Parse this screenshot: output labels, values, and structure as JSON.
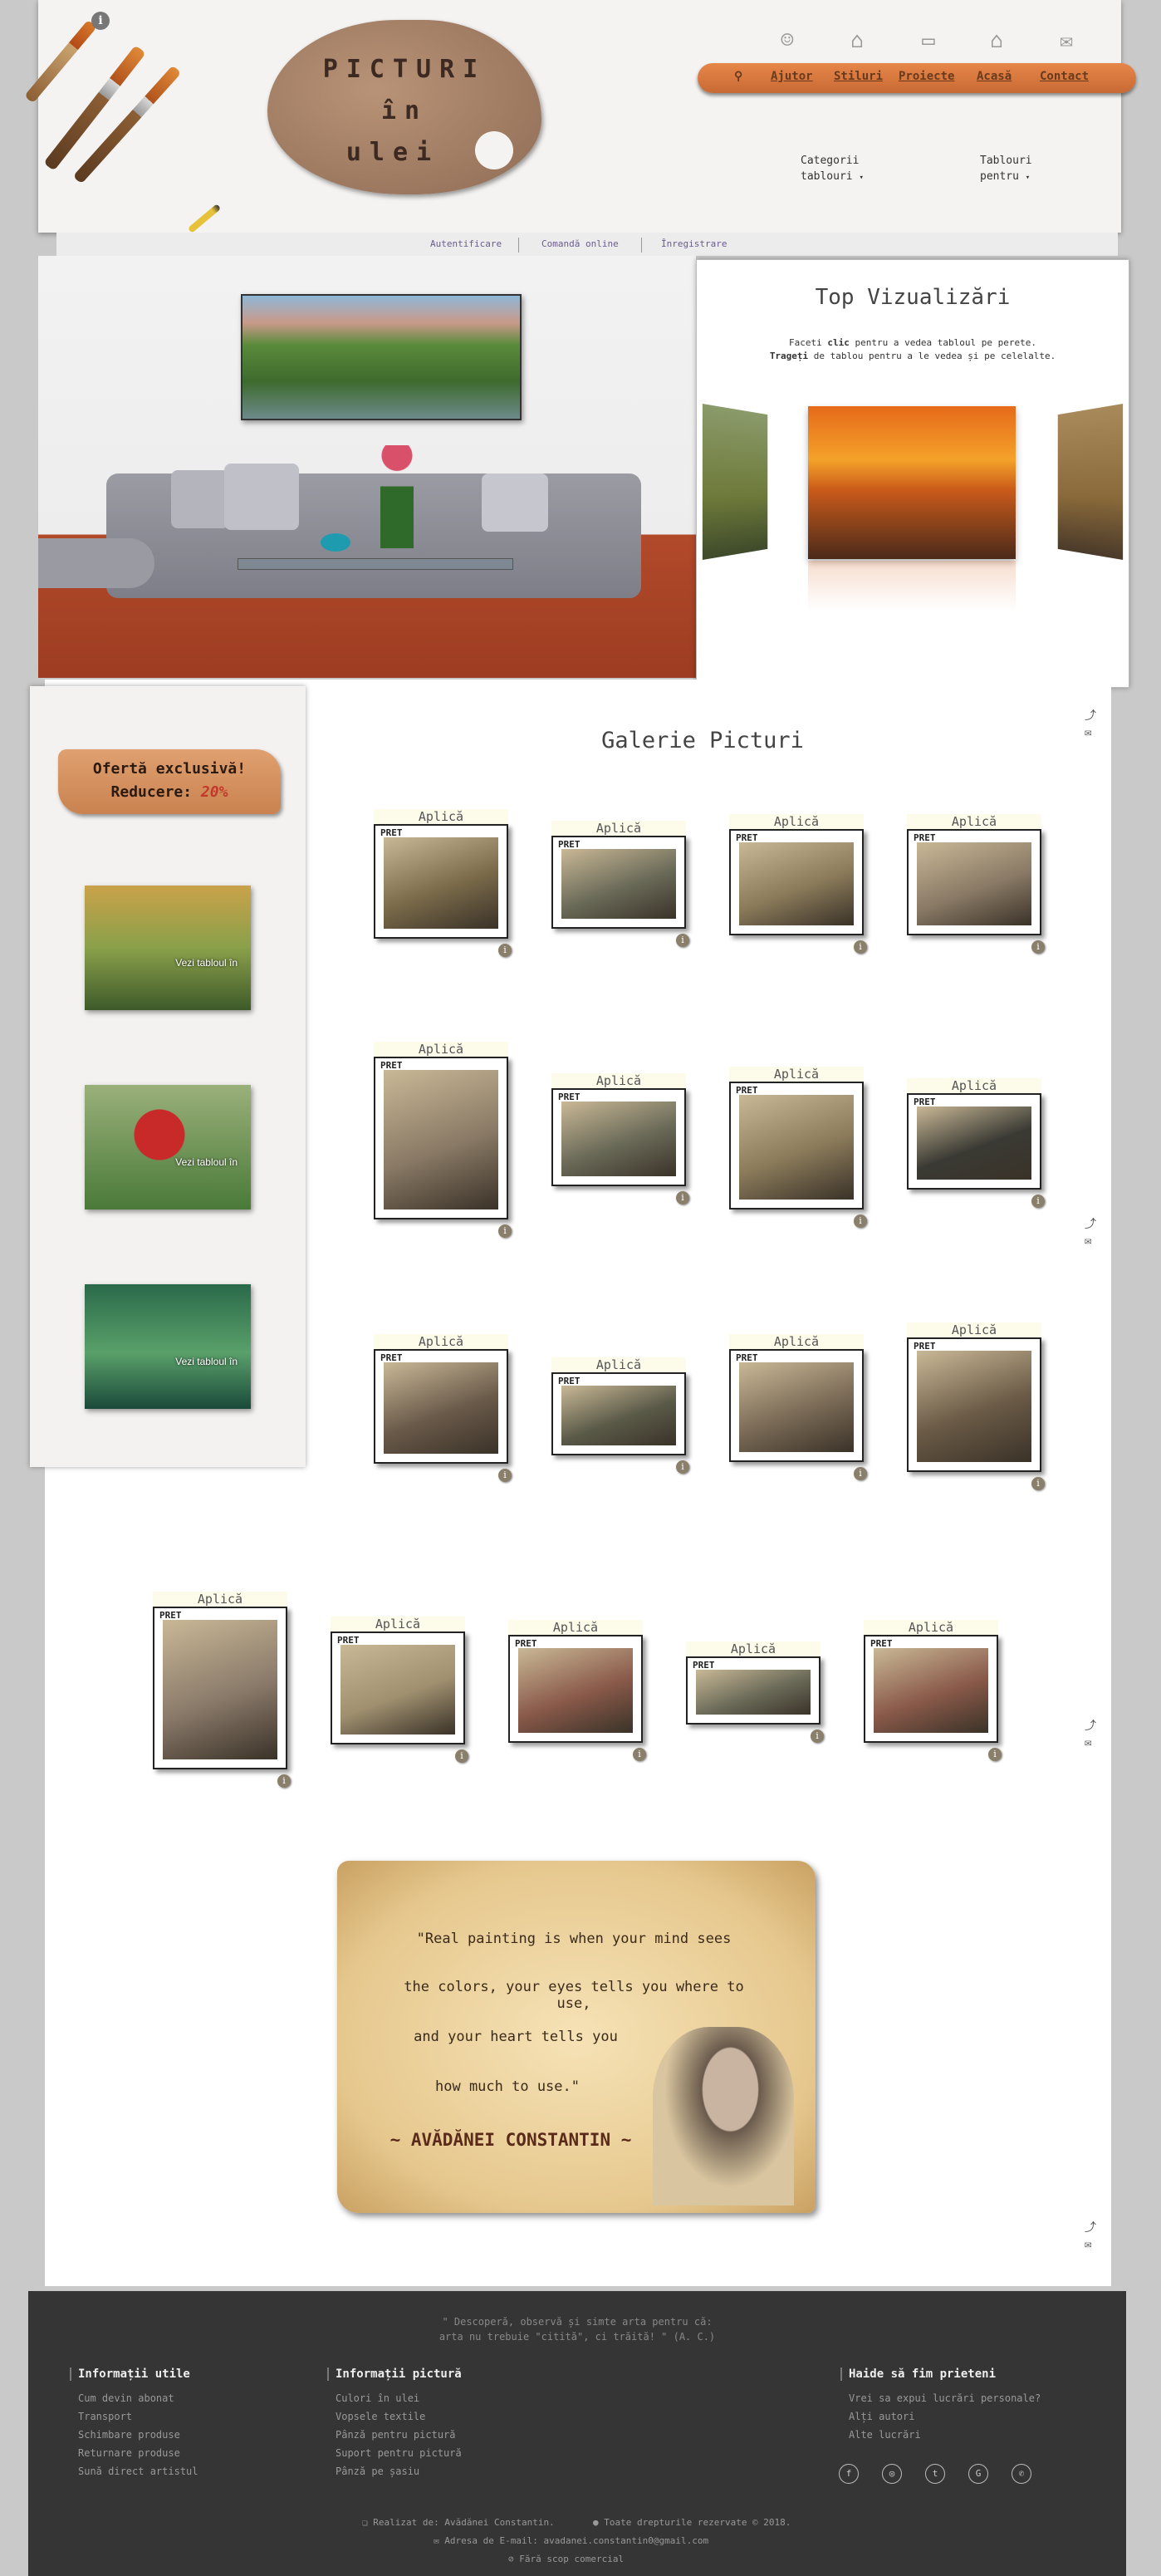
{
  "header": {
    "logo_lines": [
      "PICTURI",
      "în",
      "ulei"
    ],
    "nav": [
      "Ajutor",
      "Stiluri",
      "Proiecte",
      "Acasă",
      "Contact"
    ],
    "dropdowns": [
      {
        "line1": "Categorii",
        "line2": "tablouri"
      },
      {
        "line1": "Tablouri",
        "line2": "pentru"
      }
    ]
  },
  "subnav": [
    "Autentificare",
    "Comandă online",
    "Înregistrare"
  ],
  "top": {
    "title": "Top Vizualizări",
    "line1_pre": "Faceti ",
    "line1_bold": "clic",
    "line1_post": " pentru a vedea tabloul pe perete.",
    "line2_bold": "Trageți",
    "line2_post": " de tablou pentru a le vedea și pe celelalte."
  },
  "offer": {
    "line1": "Ofertă exclusivă!",
    "line2_pre": "Reducere: ",
    "line2_value": "20%"
  },
  "side": {
    "view_label": "Vezi tabloul în"
  },
  "gallery": {
    "title": "Galerie Picturi",
    "apply": "Aplică",
    "price": "PRET"
  },
  "quote": {
    "lines": [
      "\"Real painting is when your mind sees",
      "the colors, your eyes tells you where to use,",
      "and your heart tells you",
      "how much to use.\""
    ],
    "author": "~ AVĂDĂNEI CONSTANTIN ~"
  },
  "footer": {
    "tagline1": "\" Descoperă, observă și simte arta pentru că:",
    "tagline2": "arta nu trebuie \"citită\", ci trăită! \" (A. C.)",
    "col1": {
      "title": "Informații utile",
      "items": [
        "Cum devin abonat",
        "Transport",
        "Schimbare produse",
        "Returnare produse",
        "Sună direct artistul"
      ]
    },
    "col2": {
      "title": "Informații pictură",
      "items": [
        "Culori în ulei",
        "Vopsele textile",
        "Pânză pentru pictură",
        "Suport pentru pictură",
        "Pânză pe șasiu"
      ]
    },
    "col3": {
      "title": "Haide să fim prieteni",
      "items": [
        "Vrei sa expui lucrări personale?",
        "Alți autori",
        "Alte lucrări"
      ]
    },
    "credit": "Realizat de: Avădănei Constantin.",
    "rights": "Toate drepturile rezervate © 2018.",
    "email": "Adresa de E-mail: avadanei.constantin0@gmail.com",
    "nonprofit": "Fără scop comercial"
  },
  "colors": {
    "accent": "#d67a3e",
    "footer_bg": "#353535",
    "discount": "#c0392b"
  }
}
